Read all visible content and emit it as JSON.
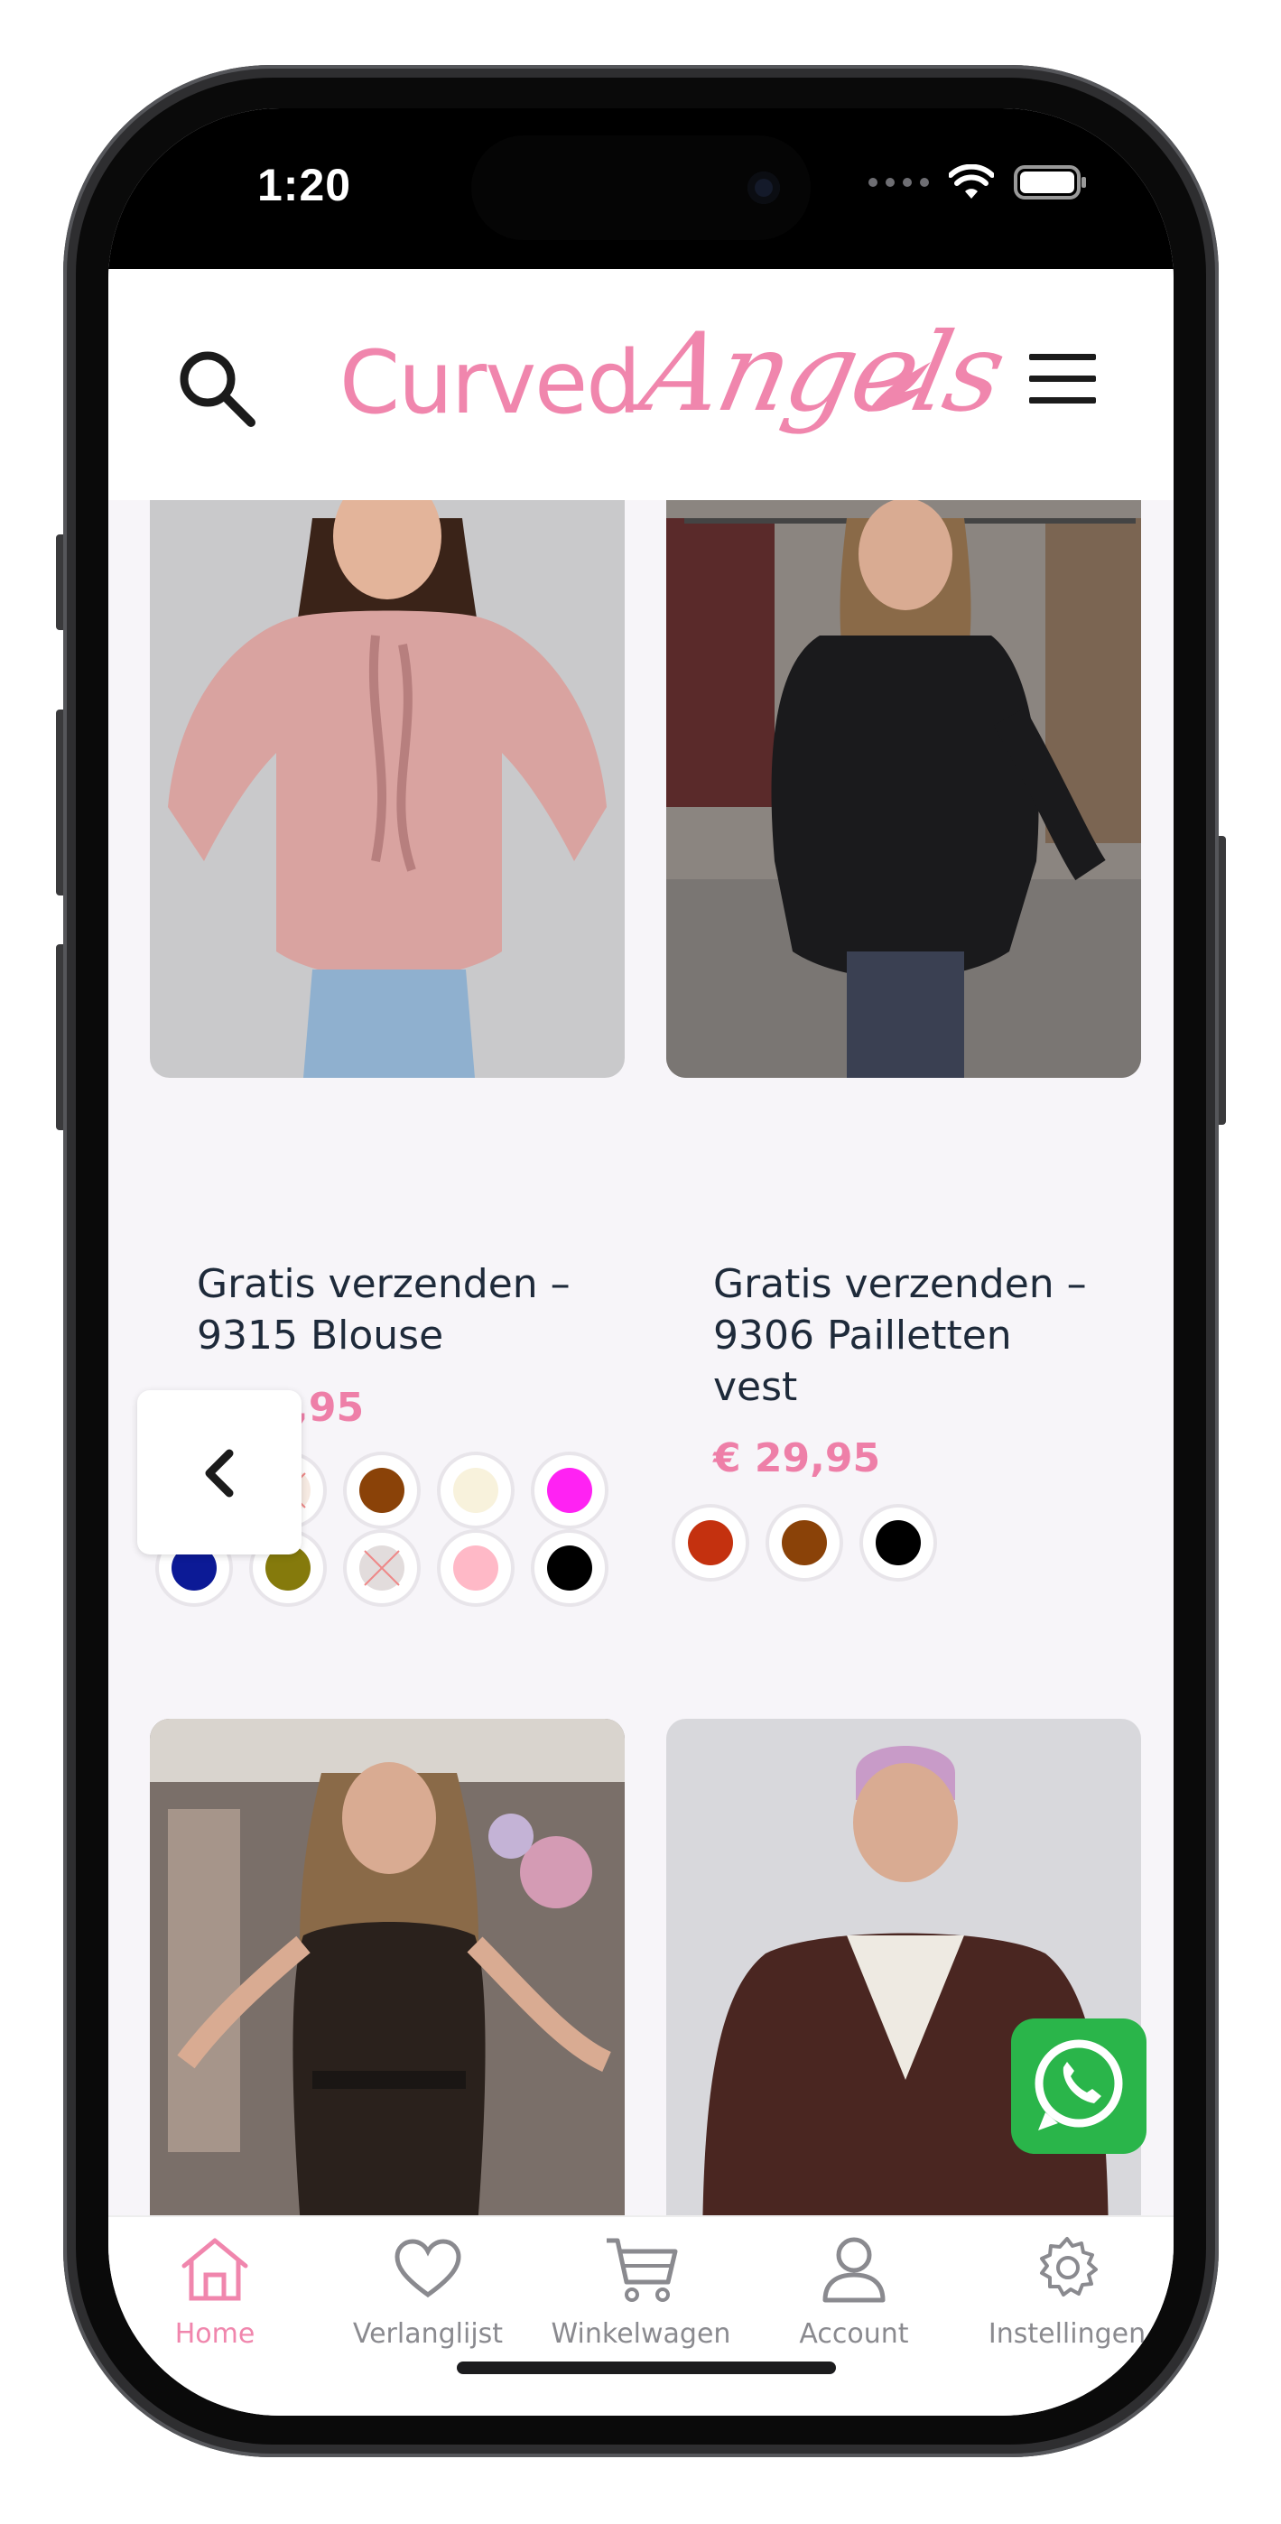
{
  "status": {
    "time": "1:20"
  },
  "brand": {
    "name_part1": "Curved",
    "name_part2": "Angels"
  },
  "products": [
    {
      "title": "Gratis verzenden – 9315 Blouse",
      "price": "€ 24,95",
      "swatches": [
        "#c4310f",
        "unavailable",
        "#8a4208",
        "#f8f2dc",
        "#ff22f3",
        "#0c1a96",
        "#857a0c",
        "unavailable",
        "#ffb9c7",
        "#000000"
      ]
    },
    {
      "title": "Gratis verzenden – 9306 Pailletten vest",
      "price": "€ 29,95",
      "swatches": [
        "#c4310f",
        "#8a4208",
        "#000000"
      ]
    }
  ],
  "nav": {
    "home": "Home",
    "wishlist": "Verlanglijst",
    "cart": "Winkelwagen",
    "account": "Account",
    "settings": "Instellingen"
  },
  "colors": {
    "accent": "#f086ad",
    "price": "#ee7fa8",
    "whatsapp": "#2ab54a"
  }
}
